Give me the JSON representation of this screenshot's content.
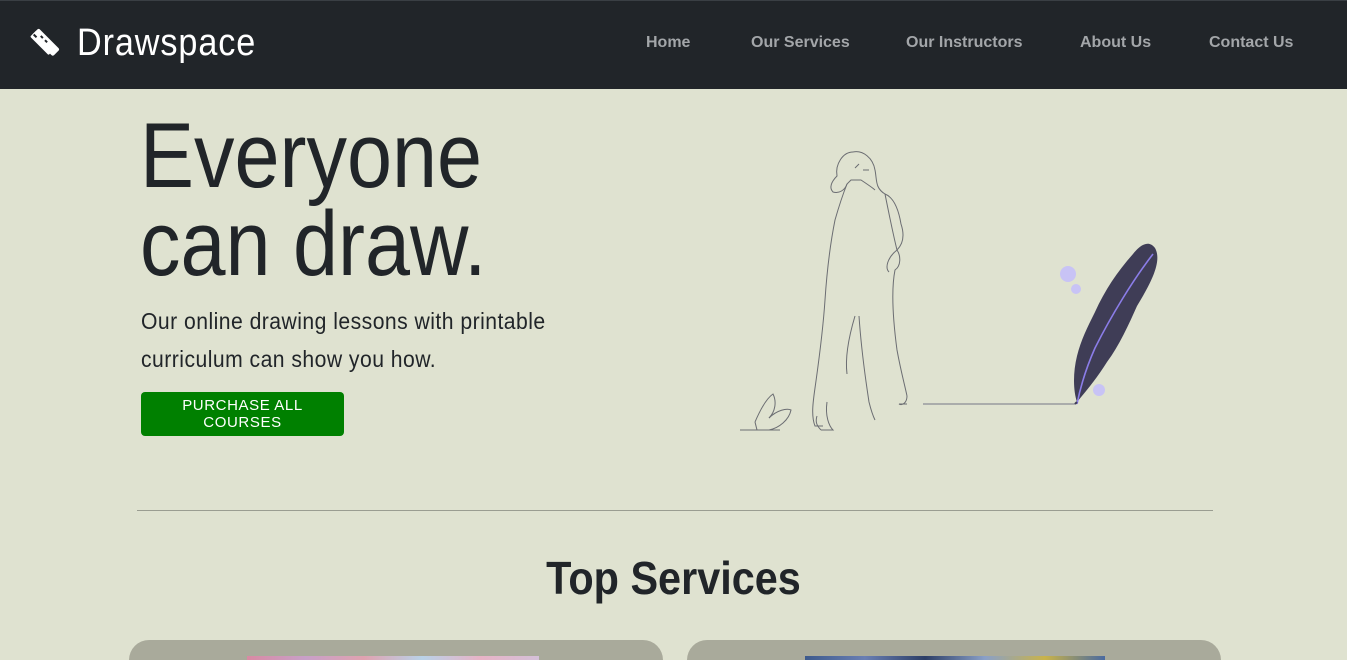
{
  "navbar": {
    "brand": "Drawspace",
    "brand_icon": "pencil-ruler-icon",
    "links": [
      "Home",
      "Our Services",
      "Our Instructors",
      "About Us",
      "Contact Us"
    ]
  },
  "hero": {
    "title_line1": "Everyone",
    "title_line2": "can draw.",
    "subtitle_line1": "Our online drawing lessons with printable",
    "subtitle_line2": "curriculum can show you how.",
    "cta_label": "PURCHASE ALL COURSES",
    "illustration": "woman-with-feather-quill-illustration"
  },
  "services": {
    "title": "Top Services"
  },
  "colors": {
    "navbar_bg": "#212529",
    "page_bg": "#dfe2d0",
    "cta_bg": "#008000",
    "nav_text": "#a3a6a9",
    "feather": "#3f3d56",
    "accent_dots": "#c8c3f5"
  }
}
